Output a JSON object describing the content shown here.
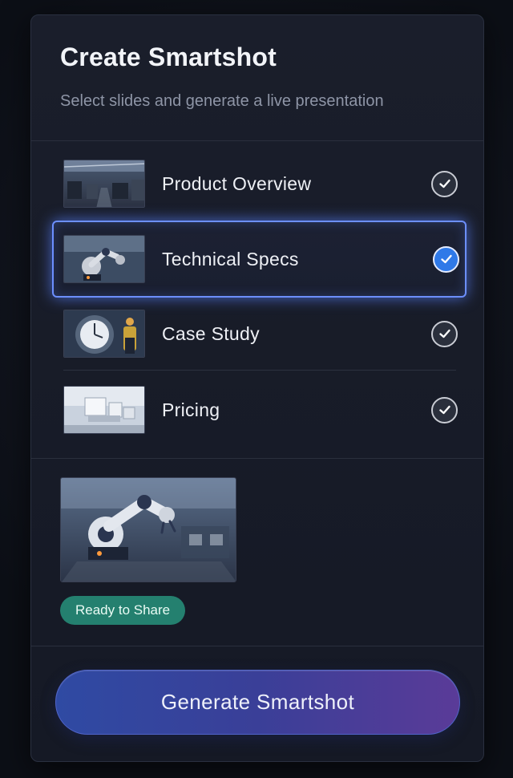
{
  "panel": {
    "title": "Create Smartshot",
    "subtitle": "Select slides and generate a live presentation"
  },
  "slides": [
    {
      "label": "Product Overview",
      "selected": false,
      "thumbnail": "factory-floor-image"
    },
    {
      "label": "Technical Specs",
      "selected": true,
      "thumbnail": "robot-arm-image"
    },
    {
      "label": "Case Study",
      "selected": false,
      "thumbnail": "worker-clock-image"
    },
    {
      "label": "Pricing",
      "selected": false,
      "thumbnail": "equipment-render-image"
    }
  ],
  "preview": {
    "image": "robot-arm-preview-image",
    "badge": "Ready to Share"
  },
  "actions": {
    "generate_label": "Generate Smartshot"
  },
  "colors": {
    "accent": "#6c8fff",
    "selected_check": "#2f79e8",
    "badge_bg": "#24806f",
    "button_gradient_start": "#2f4aa3",
    "button_gradient_end": "#5a3b98"
  }
}
